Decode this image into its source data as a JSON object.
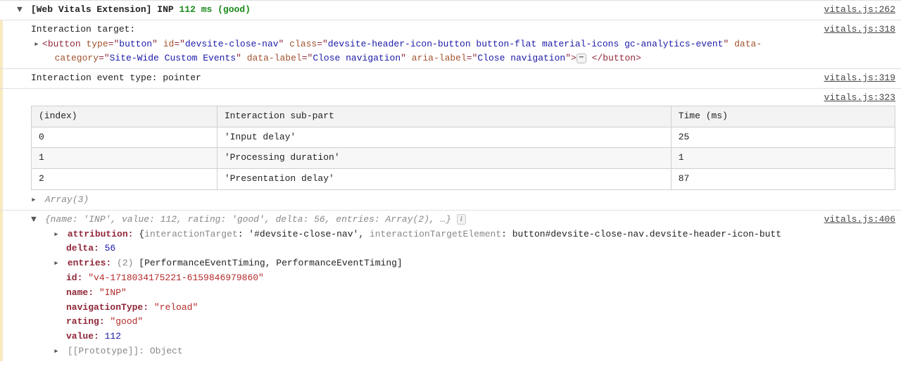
{
  "header": {
    "prefix": "[Web Vitals Extension]",
    "metric": "INP",
    "value": "112 ms",
    "rating": "(good)",
    "src": "vitals.js:262"
  },
  "target": {
    "label": "Interaction target:",
    "src": "vitals.js:318",
    "tag": "button",
    "attrs": {
      "type": "button",
      "id": "devsite-close-nav",
      "class": "devsite-header-icon-button button-flat material-icons gc-analytics-event",
      "data_category": "Site-Wide Custom Events",
      "data_label": "Close navigation",
      "aria_label": "Close navigation"
    },
    "closeTag": "</button>"
  },
  "eventType": {
    "label": "Interaction event type: pointer",
    "src": "vitals.js:319"
  },
  "tableBlock": {
    "src": "vitals.js:323",
    "headers": {
      "c0": "(index)",
      "c1": "Interaction sub-part",
      "c2": "Time (ms)"
    },
    "rows": [
      {
        "idx": "0",
        "part": "'Input delay'",
        "time": "25"
      },
      {
        "idx": "1",
        "part": "'Processing duration'",
        "time": "1"
      },
      {
        "idx": "2",
        "part": "'Presentation delay'",
        "time": "87"
      }
    ],
    "array": "Array(3)",
    "chart_data": {
      "type": "table",
      "columns": [
        "(index)",
        "Interaction sub-part",
        "Time (ms)"
      ],
      "rows": [
        [
          0,
          "Input delay",
          25
        ],
        [
          1,
          "Processing duration",
          1
        ],
        [
          2,
          "Presentation delay",
          87
        ]
      ]
    }
  },
  "obj": {
    "src": "vitals.js:406",
    "preview": {
      "p1": "{name: 'INP', value: 112, rating: 'good', delta: 56, entries: Array(2), …}"
    },
    "attribution": {
      "key": "attribution:",
      "open": "{",
      "k1": "interactionTarget",
      "v1": ": '#devsite-close-nav', ",
      "k2": "interactionTargetElement",
      "v2": ": button#devsite-close-nav.devsite-header-icon-butt"
    },
    "delta": {
      "key": "delta:",
      "val": "56"
    },
    "entries": {
      "key": "entries:",
      "count": "(2)",
      "val": "[PerformanceEventTiming, PerformanceEventTiming]"
    },
    "id": {
      "key": "id:",
      "val": "\"v4-1718034175221-6159846979860\""
    },
    "name": {
      "key": "name:",
      "val": "\"INP\""
    },
    "navigationType": {
      "key": "navigationType:",
      "val": "\"reload\""
    },
    "rating": {
      "key": "rating:",
      "val": "\"good\""
    },
    "value": {
      "key": "value:",
      "val": "112"
    },
    "prototype": {
      "key": "[[Prototype]]",
      "val": ": Object"
    }
  }
}
